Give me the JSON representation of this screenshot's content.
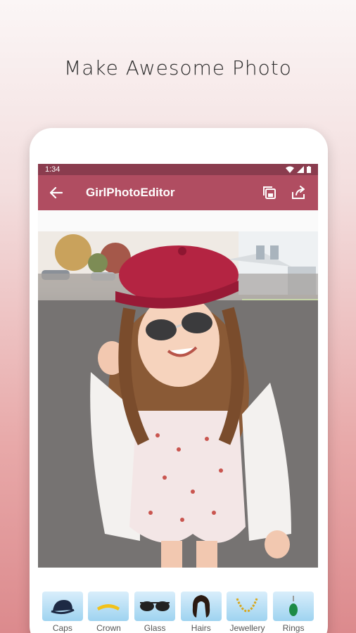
{
  "headline": "Make Awesome Photo",
  "status": {
    "time": "1:34"
  },
  "appbar": {
    "title": "GirlPhotoEditor"
  },
  "colors": {
    "statusbar": "#8a3c4e",
    "appbar": "#b04d61",
    "tile": "#9ed3f0"
  },
  "tools": [
    {
      "label": "Caps",
      "icon": "cap-icon"
    },
    {
      "label": "Crown",
      "icon": "crown-icon"
    },
    {
      "label": "Glass",
      "icon": "sunglasses-icon"
    },
    {
      "label": "Hairs",
      "icon": "hair-icon"
    },
    {
      "label": "Jewellery",
      "icon": "necklace-icon"
    },
    {
      "label": "Rings",
      "icon": "ring-icon"
    }
  ]
}
